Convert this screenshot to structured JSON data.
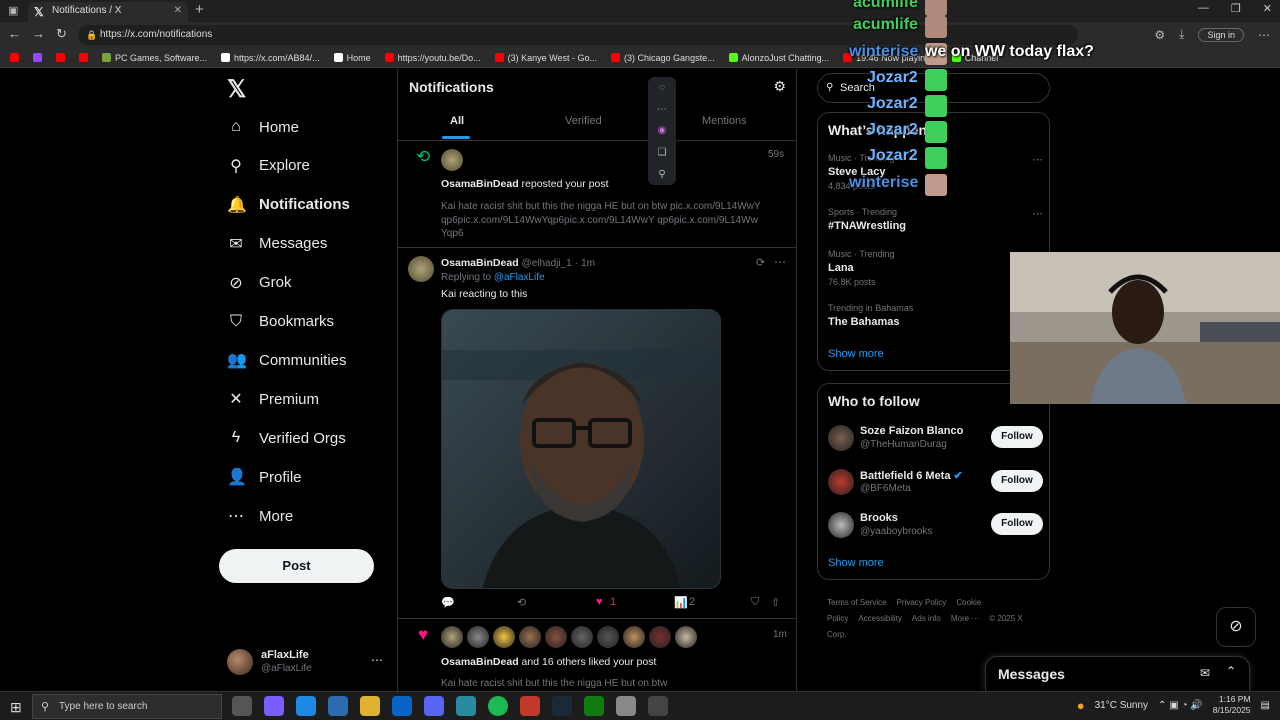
{
  "browser": {
    "tab_title": "Notifications / X",
    "url": "https://x.com/notifications",
    "signin_label": "Sign in",
    "bookmarks": [
      {
        "label": "",
        "color": "#ff0000"
      },
      {
        "label": "",
        "color": "#9146ff"
      },
      {
        "label": "",
        "color": "#ff0000"
      },
      {
        "label": "",
        "color": "#ff0000"
      },
      {
        "label": "PC Games, Software...",
        "color": "#7aa33a"
      },
      {
        "label": "https://x.com/AB84/...",
        "color": "#ffffff"
      },
      {
        "label": "Home",
        "color": "#ffffff"
      },
      {
        "label": "https://youtu.be/Do...",
        "color": "#ff0000"
      },
      {
        "label": "(3) Kanye West - Go...",
        "color": "#ff0000"
      },
      {
        "label": "(3) Chicago Gangste...",
        "color": "#ff0000"
      },
      {
        "label": "AlonzoJust Chatting...",
        "color": "#53fc18"
      },
      {
        "label": "19:46 Now playing...",
        "color": "#ff0000"
      },
      {
        "label": "Channel",
        "color": "#53fc18"
      }
    ]
  },
  "nav": {
    "items": [
      {
        "label": "Home",
        "icon": "home-icon",
        "glyph": "⌂"
      },
      {
        "label": "Explore",
        "icon": "search-icon",
        "glyph": "⚲"
      },
      {
        "label": "Notifications",
        "icon": "bell-icon",
        "glyph": "🔔"
      },
      {
        "label": "Messages",
        "icon": "mail-icon",
        "glyph": "✉"
      },
      {
        "label": "Grok",
        "icon": "grok-icon",
        "glyph": "⊘"
      },
      {
        "label": "Bookmarks",
        "icon": "bookmark-icon",
        "glyph": "⛉"
      },
      {
        "label": "Communities",
        "icon": "people-icon",
        "glyph": "👥"
      },
      {
        "label": "Premium",
        "icon": "x-icon",
        "glyph": "✕"
      },
      {
        "label": "Verified Orgs",
        "icon": "lightning-icon",
        "glyph": "ϟ"
      },
      {
        "label": "Profile",
        "icon": "person-icon",
        "glyph": "👤"
      },
      {
        "label": "More",
        "icon": "more-circle-icon",
        "glyph": "⋯"
      }
    ],
    "post_label": "Post",
    "account_name": "aFlaxLife",
    "account_handle": "@aFlaxLife"
  },
  "notifications": {
    "title": "Notifications",
    "tabs": [
      "All",
      "Verified",
      "Mentions"
    ],
    "repost": {
      "time": "59s",
      "user": "OsamaBinDead",
      "action": "reposted your post",
      "text": "Kai hate racist shit but this the nigga HE but on btw pic.x.com/9L14WwYqp6pic.x.com/9L14WwYqp6pic.x.com/9L14WwY qp6pic.x.com/9L14WwYqp6"
    },
    "reply": {
      "user": "OsamaBinDead",
      "handle": "@elhadji_1",
      "sep": "·",
      "time": "1m",
      "replying_prefix": "Replying to",
      "replying_to": "@aFlaxLife",
      "text": "Kai reacting to this",
      "likes": "1",
      "views": "2"
    },
    "likes_notif": {
      "time": "1m",
      "user": "OsamaBinDead",
      "action": "and 16 others liked your post",
      "text": "Kai hate racist shit but this the nigga HE but on btw"
    }
  },
  "sidebar": {
    "search_placeholder": "Search",
    "trends_title": "What’s happening",
    "trends": [
      {
        "meta": "Music · Trending",
        "name": "Steve Lacy",
        "count": "4,834 posts"
      },
      {
        "meta": "Sports · Trending",
        "name": "#TNAWrestling",
        "count": ""
      },
      {
        "meta": "Music · Trending",
        "name": "Lana",
        "count": "76.8K posts"
      },
      {
        "meta": "Trending in Bahamas",
        "name": "The Bahamas",
        "count": ""
      }
    ],
    "show_more": "Show more",
    "follow_title": "Who to follow",
    "follows": [
      {
        "name": "Soze Faizon Blanco",
        "handle": "@TheHumanDurag",
        "verified": false
      },
      {
        "name": "Battlefield 6 Meta",
        "handle": "@BF6Meta",
        "verified": true
      },
      {
        "name": "Brooks",
        "handle": "@yaaboybrooks",
        "verified": false
      }
    ],
    "follow_label": "Follow",
    "footer_links": [
      "Terms of Service",
      "Privacy Policy",
      "Cookie Policy",
      "Accessibility",
      "Ads info",
      "More ···",
      "© 2025 X Corp."
    ],
    "messages_title": "Messages"
  },
  "stream_chat": [
    {
      "user": "acumlife",
      "msg": "",
      "color": "#3fcf5a"
    },
    {
      "user": "acumlife",
      "msg": "",
      "color": "#3fcf5a"
    },
    {
      "user": "winterise",
      "msg": "we on WW today flax?",
      "color": "#4a8fe0"
    },
    {
      "user": "Jozar2",
      "msg": "",
      "color": "#6fb3ff"
    },
    {
      "user": "Jozar2",
      "msg": "",
      "color": "#6fb3ff"
    },
    {
      "user": "Jozar2",
      "msg": "",
      "color": "#6fb3ff"
    },
    {
      "user": "Jozar2",
      "msg": "",
      "color": "#6fb3ff"
    },
    {
      "user": "winterise",
      "msg": "",
      "color": "#4a8fe0"
    }
  ],
  "taskbar": {
    "search_placeholder": "Type here to search",
    "weather": "31°C  Sunny",
    "time": "1:16 PM",
    "date": "8/15/2025"
  },
  "colors": {
    "accent": "#1d9bf0",
    "like": "#f91880",
    "repost": "#00ba7c"
  }
}
